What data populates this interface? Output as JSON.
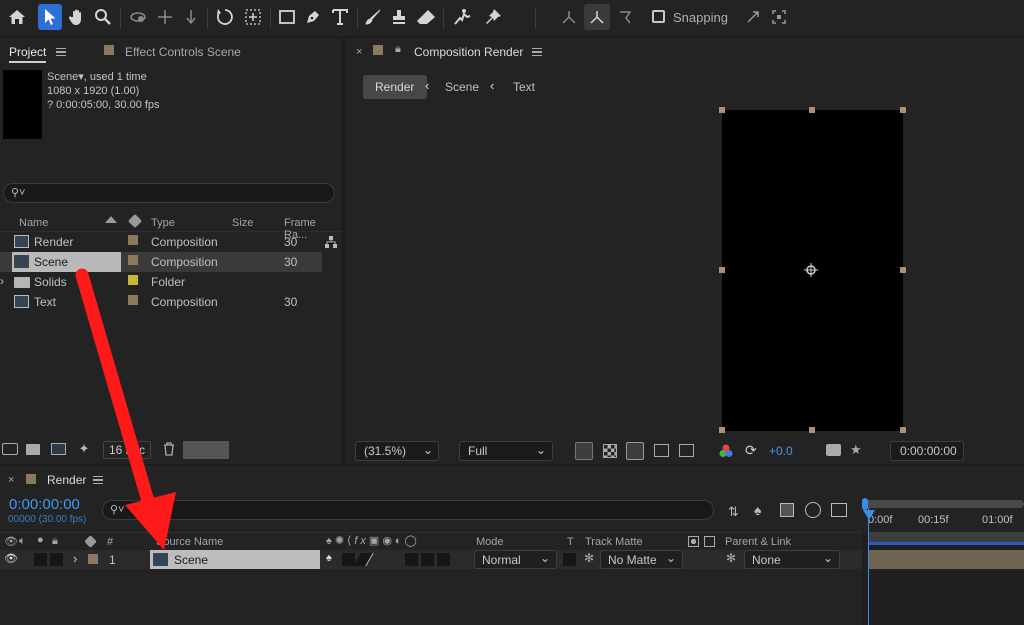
{
  "toolbar": {
    "snapping_label": "Snapping",
    "tools": [
      "home-icon",
      "selection-tool-icon",
      "hand-tool-icon",
      "zoom-tool-icon",
      "orbit-camera-icon",
      "pan-camera-icon",
      "dolly-camera-icon",
      "rotation-tool-icon",
      "pan-behind-tool-icon",
      "rectangle-tool-icon",
      "pen-tool-icon",
      "type-tool-icon",
      "brush-tool-icon",
      "clone-stamp-icon",
      "eraser-icon",
      "roto-brush-icon",
      "puppet-pin-icon"
    ]
  },
  "project": {
    "tab_label": "Project",
    "effect_tab_label": "Effect Controls Scene",
    "preview_name": "Scene",
    "preview_used": ", used 1 time",
    "preview_dims": "1080 x 1920 (1.00)",
    "preview_duration": "? 0:00:05:00, 30.00 fps",
    "search_placeholder": "",
    "columns": {
      "name": "Name",
      "type": "Type",
      "size": "Size",
      "frame_rate": "Frame Ra..."
    },
    "items": [
      {
        "name": "Render",
        "type": "Composition",
        "fps": "30",
        "color": "#8b7a5e"
      },
      {
        "name": "Scene",
        "type": "Composition",
        "fps": "30",
        "color": "#8b7a5e"
      },
      {
        "name": "Solids",
        "type": "Folder",
        "fps": "",
        "color": "#c8b63c"
      },
      {
        "name": "Text",
        "type": "Composition",
        "fps": "30",
        "color": "#8b7a5e"
      }
    ],
    "bpc": "16 bpc"
  },
  "composition": {
    "tab_label": "Composition Render",
    "breadcrumbs": [
      "Render",
      "Scene",
      "Text"
    ],
    "zoom": "(31.5%)",
    "resolution": "Full",
    "exposure": "+0.0",
    "timecode": "0:00:00:00"
  },
  "timeline": {
    "tab_label": "Render",
    "timecode": "0:00:00:00",
    "frames": "00000 (30.00 fps)",
    "columns": {
      "num": "#",
      "source": "Source Name",
      "mode": "Mode",
      "t": "T",
      "track_matte": "Track Matte",
      "parent": "Parent & Link"
    },
    "ruler": [
      "0:00f",
      "00:15f",
      "01:00f"
    ],
    "layer": {
      "index": "1",
      "name": "Scene",
      "mode": "Normal",
      "matte": "No Matte",
      "parent": "None"
    }
  },
  "colors": {
    "accent": "#2d8ceb",
    "arrow": "#ff1a1a",
    "label_tan": "#8b7a5e",
    "handle": "#a89274"
  }
}
